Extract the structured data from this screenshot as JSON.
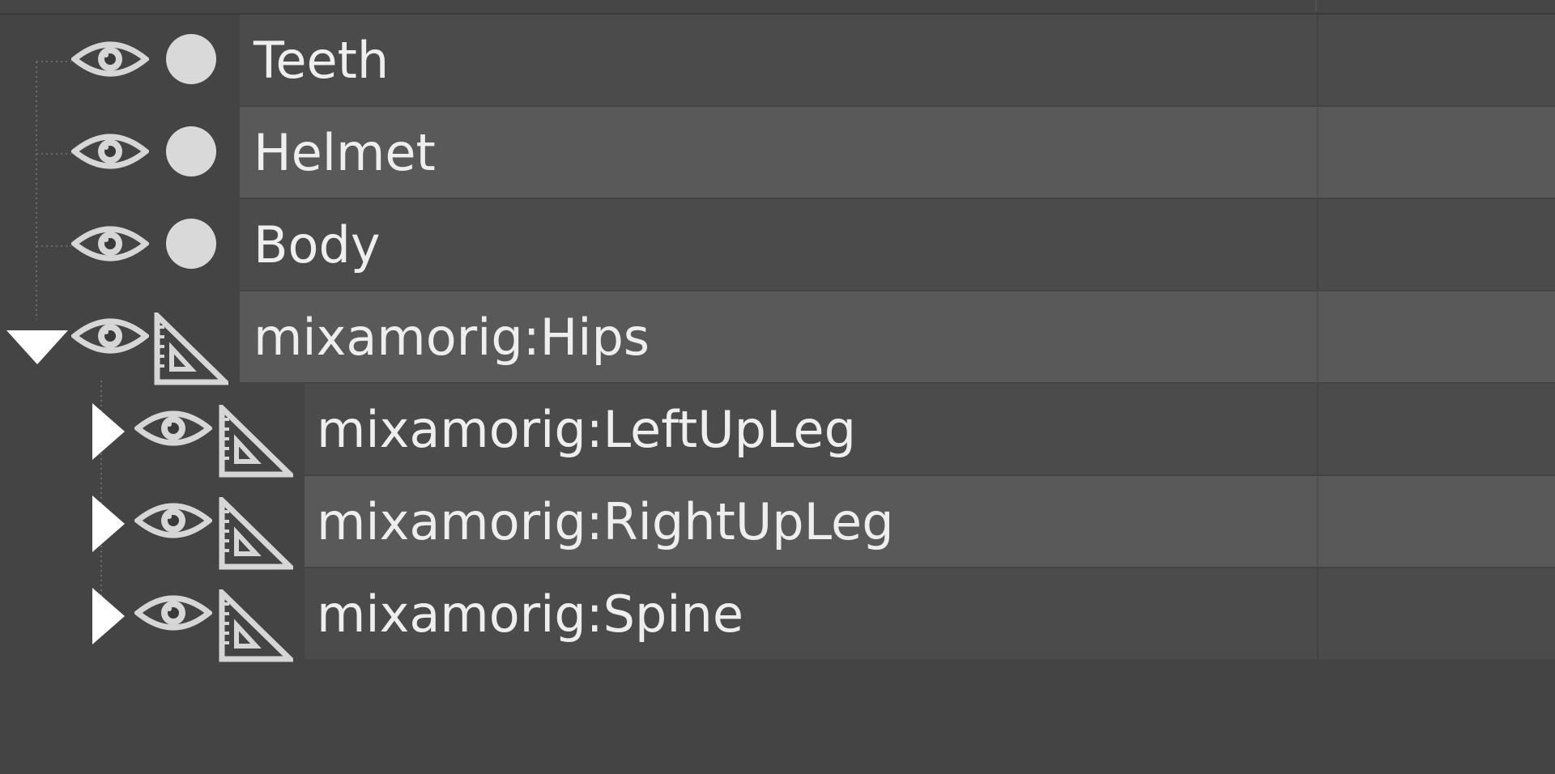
{
  "outliner": {
    "rows": [
      {
        "label": "Teeth",
        "type": "mesh",
        "depth": 0,
        "expander": "none",
        "visible": true
      },
      {
        "label": "Helmet",
        "type": "mesh",
        "depth": 0,
        "expander": "none",
        "visible": true
      },
      {
        "label": "Body",
        "type": "mesh",
        "depth": 0,
        "expander": "none",
        "visible": true
      },
      {
        "label": "mixamorig:Hips",
        "type": "joint",
        "depth": 0,
        "expander": "expanded",
        "visible": true
      },
      {
        "label": "mixamorig:LeftUpLeg",
        "type": "joint",
        "depth": 1,
        "expander": "collapsed",
        "visible": true
      },
      {
        "label": "mixamorig:RightUpLeg",
        "type": "joint",
        "depth": 1,
        "expander": "collapsed",
        "visible": true
      },
      {
        "label": "mixamorig:Spine",
        "type": "joint",
        "depth": 1,
        "expander": "collapsed",
        "visible": true
      }
    ]
  },
  "colors": {
    "panel": "#444444",
    "row_even": "#4b4b4b",
    "row_odd": "#595959",
    "text": "#eeeeee",
    "icon": "#d6d6d6"
  }
}
